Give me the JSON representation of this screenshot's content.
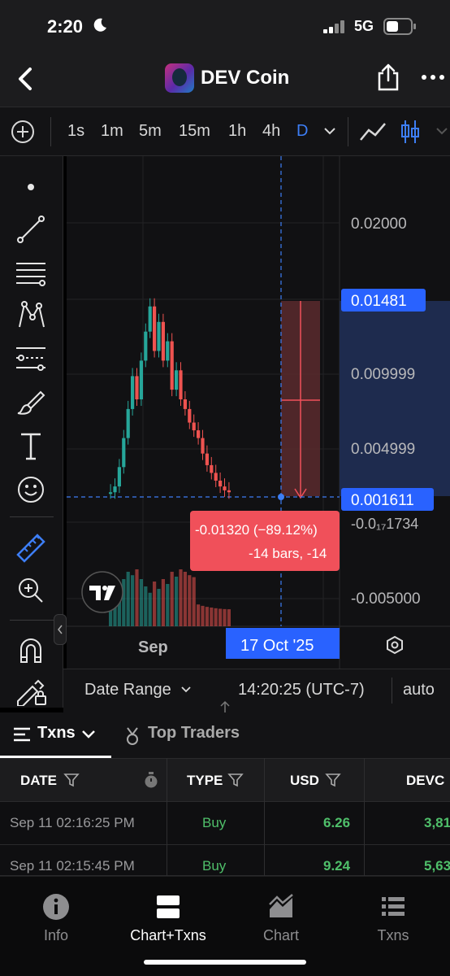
{
  "status": {
    "time": "2:20",
    "network": "5G"
  },
  "header": {
    "title": "DEV Coin"
  },
  "toolbar": {
    "intervals": [
      "1s",
      "1m",
      "5m",
      "15m",
      "1h",
      "4h",
      "D"
    ],
    "active_interval": "D"
  },
  "chart": {
    "price_labels": [
      "0.02000",
      "0.01481",
      "0.009999",
      "0.004999",
      "0.001611",
      "-0.0₁₇1734",
      "-0.005000"
    ],
    "measure_line1": "-0.01320 (−89.12%)",
    "measure_line2": "-14 bars, -14",
    "x_label": "Sep",
    "crosshair_date": "17 Oct '25",
    "colors": {
      "up": "#26a69a",
      "down": "#ef5350",
      "accent": "#2962ff",
      "measure": "#f0505a"
    }
  },
  "range_bar": {
    "label": "Date Range",
    "time": "14:20:25 (UTC-7)",
    "mode": "auto"
  },
  "tabs": [
    {
      "label": "Txns"
    },
    {
      "label": "Top Traders"
    }
  ],
  "table": {
    "headers": [
      "DATE",
      "TYPE",
      "USD",
      "DEVC"
    ],
    "rows": [
      {
        "date": "Sep 11 02:16:25 PM",
        "type": "Buy",
        "usd": "6.26",
        "devc": "3,81"
      },
      {
        "date": "Sep 11 02:15:45 PM",
        "type": "Buy",
        "usd": "9.24",
        "devc": "5,63"
      }
    ]
  },
  "nav": [
    {
      "label": "Info",
      "icon": "info-icon"
    },
    {
      "label": "Chart+Txns",
      "icon": "chart-txns-icon"
    },
    {
      "label": "Chart",
      "icon": "chart-icon"
    },
    {
      "label": "Txns",
      "icon": "list-icon"
    }
  ]
}
